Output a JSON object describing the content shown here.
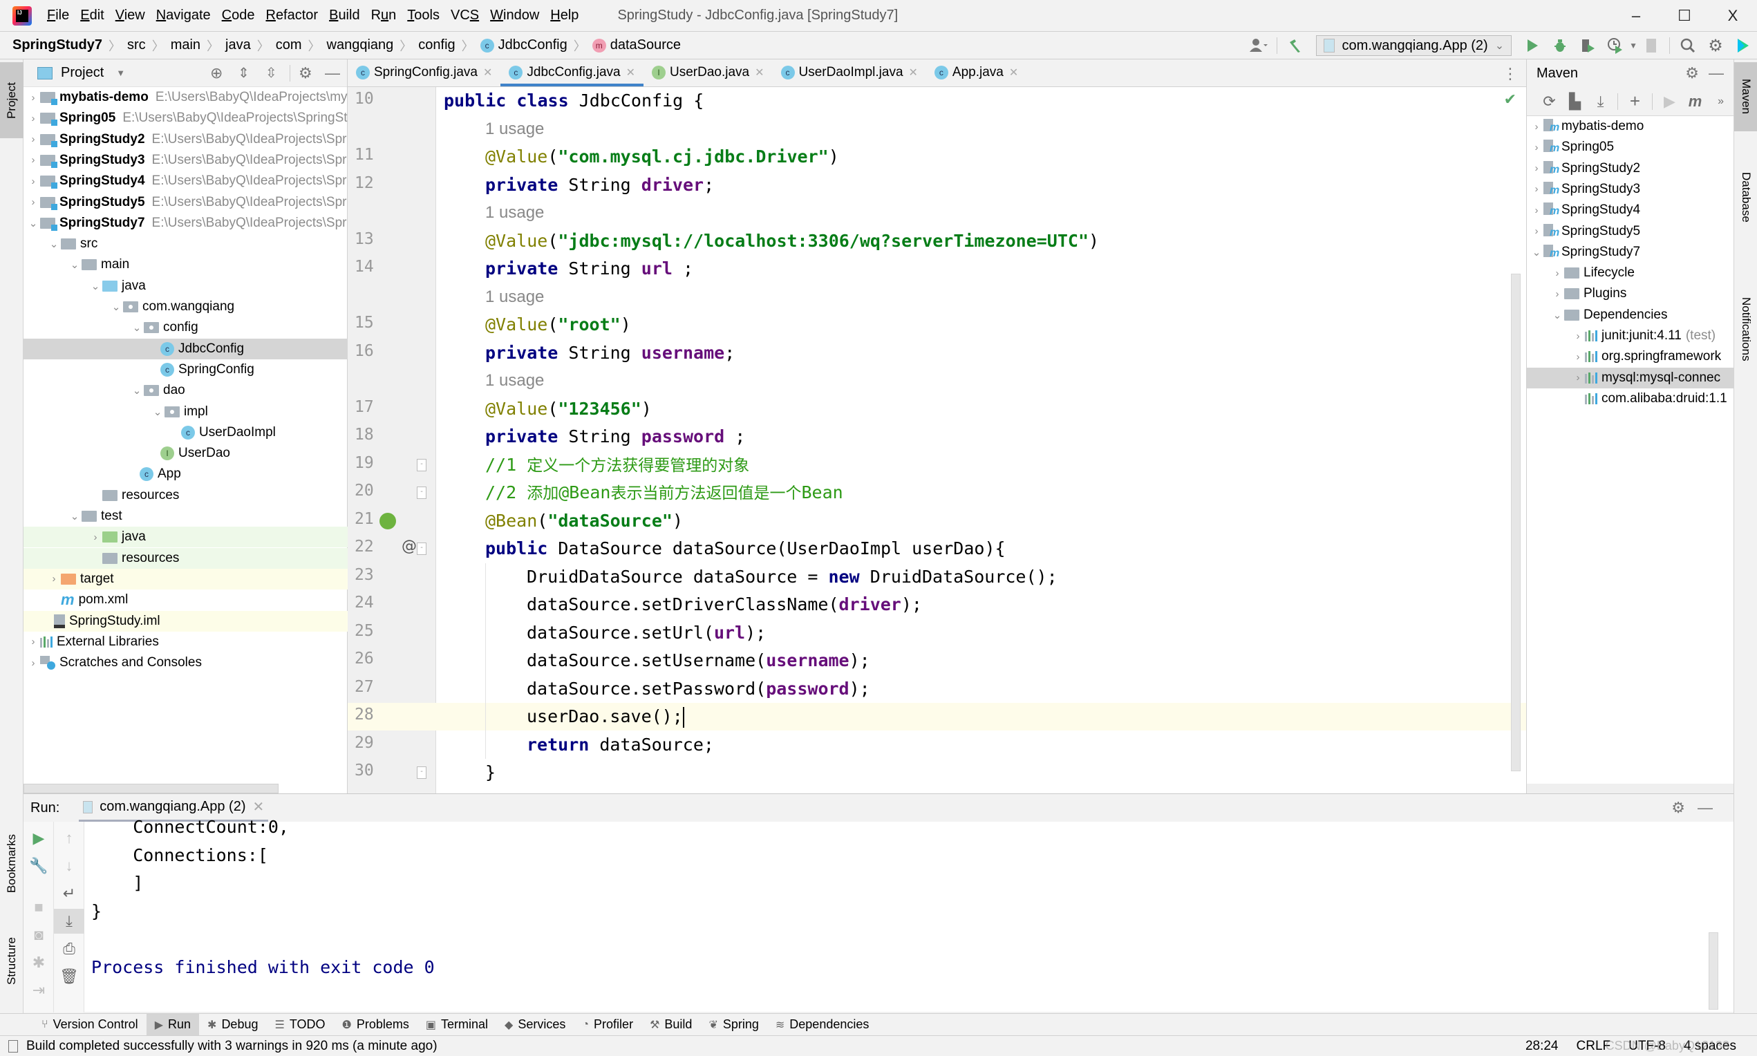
{
  "window": {
    "title": "SpringStudy - JdbcConfig.java [SpringStudy7]",
    "menu": [
      "File",
      "Edit",
      "View",
      "Navigate",
      "Code",
      "Refactor",
      "Build",
      "Run",
      "Tools",
      "VCS",
      "Window",
      "Help"
    ],
    "menu_mnemonics": [
      "F",
      "E",
      "V",
      "N",
      "C",
      "R",
      "B",
      "u",
      "T",
      "S",
      "W",
      "H"
    ],
    "controls": {
      "minimize": "–",
      "maximize": "☐",
      "close": "X"
    }
  },
  "breadcrumb": {
    "items": [
      "SpringStudy7",
      "src",
      "main",
      "java",
      "com",
      "wangqiang",
      "config",
      "JdbcConfig",
      "dataSource"
    ],
    "class_badge": "c",
    "method_badge": "m"
  },
  "toolbar": {
    "run_config": "com.wangqiang.App (2)",
    "icons": [
      "user-icon",
      "build-hammer-icon",
      "run-icon",
      "debug-icon",
      "coverage-icon",
      "profile-icon",
      "stop-icon",
      "search-icon",
      "settings-icon",
      "toolbox-icon"
    ]
  },
  "left_stripe": {
    "tabs": [
      "Project",
      "Bookmarks",
      "Structure"
    ]
  },
  "right_stripe": {
    "tabs": [
      "Maven",
      "Database",
      "Notifications"
    ]
  },
  "project_panel": {
    "title": "Project",
    "tree": [
      {
        "label": "mybatis-demo",
        "path": "E:\\Users\\BabyQ\\IdeaProjects\\mybatis-demo",
        "bold": true,
        "depth": 0,
        "arrow": ">",
        "icon": "module-folder"
      },
      {
        "label": "Spring05",
        "path": "E:\\Users\\BabyQ\\IdeaProjects\\SpringStudy",
        "bold": true,
        "depth": 0,
        "arrow": ">",
        "icon": "module-folder"
      },
      {
        "label": "SpringStudy2",
        "path": "E:\\Users\\BabyQ\\IdeaProjects\\Spr",
        "bold": true,
        "depth": 0,
        "arrow": ">",
        "icon": "module-folder"
      },
      {
        "label": "SpringStudy3",
        "path": "E:\\Users\\BabyQ\\IdeaProjects\\Spr",
        "bold": true,
        "depth": 0,
        "arrow": ">",
        "icon": "module-folder"
      },
      {
        "label": "SpringStudy4",
        "path": "E:\\Users\\BabyQ\\IdeaProjects\\Spr",
        "bold": true,
        "depth": 0,
        "arrow": ">",
        "icon": "module-folder"
      },
      {
        "label": "SpringStudy5",
        "path": "E:\\Users\\BabyQ\\IdeaProjects\\Spr",
        "bold": true,
        "depth": 0,
        "arrow": ">",
        "icon": "module-folder"
      },
      {
        "label": "SpringStudy7",
        "path": "E:\\Users\\BabyQ\\IdeaProjects\\Spr",
        "bold": true,
        "depth": 0,
        "arrow": "v",
        "icon": "module-folder"
      },
      {
        "label": "src",
        "depth": 1,
        "arrow": "v",
        "icon": "folder"
      },
      {
        "label": "main",
        "depth": 2,
        "arrow": "v",
        "icon": "folder"
      },
      {
        "label": "java",
        "depth": 3,
        "arrow": "v",
        "icon": "source-folder"
      },
      {
        "label": "com.wangqiang",
        "depth": 4,
        "arrow": "v",
        "icon": "package"
      },
      {
        "label": "config",
        "depth": 5,
        "arrow": "v",
        "icon": "package"
      },
      {
        "label": "JdbcConfig",
        "depth": 6,
        "arrow": "",
        "icon": "class",
        "selected": true
      },
      {
        "label": "SpringConfig",
        "depth": 6,
        "arrow": "",
        "icon": "class"
      },
      {
        "label": "dao",
        "depth": 5,
        "arrow": "v",
        "icon": "package"
      },
      {
        "label": "impl",
        "depth": 6,
        "arrow": "v",
        "icon": "package"
      },
      {
        "label": "UserDaoImpl",
        "depth": 7,
        "arrow": "",
        "icon": "class"
      },
      {
        "label": "UserDao",
        "depth": 6,
        "arrow": "",
        "icon": "interface"
      },
      {
        "label": "App",
        "depth": 5,
        "arrow": "",
        "icon": "runnable-class"
      },
      {
        "label": "resources",
        "depth": 3,
        "arrow": "",
        "icon": "resources-folder"
      },
      {
        "label": "test",
        "depth": 2,
        "arrow": "v",
        "icon": "folder"
      },
      {
        "label": "java",
        "depth": 3,
        "arrow": ">",
        "icon": "test-folder",
        "highlight": "green"
      },
      {
        "label": "resources",
        "depth": 3,
        "arrow": "",
        "icon": "test-resources-folder",
        "highlight": "green"
      },
      {
        "label": "target",
        "depth": 1,
        "arrow": ">",
        "icon": "excluded-folder",
        "highlight": "yellow"
      },
      {
        "label": "pom.xml",
        "depth": 1,
        "arrow": "",
        "icon": "maven-file"
      },
      {
        "label": "SpringStudy.iml",
        "depth": 0,
        "arrow": "",
        "icon": "iml-file",
        "highlight": "yellow"
      },
      {
        "label": "External Libraries",
        "depth": -1,
        "arrow": ">",
        "icon": "libraries"
      },
      {
        "label": "Scratches and Consoles",
        "depth": -1,
        "arrow": ">",
        "icon": "scratches"
      }
    ]
  },
  "editor": {
    "tabs": [
      {
        "label": "SpringConfig.java",
        "badge": "c",
        "active": false
      },
      {
        "label": "JdbcConfig.java",
        "badge": "c",
        "active": true
      },
      {
        "label": "UserDao.java",
        "badge": "I",
        "active": false
      },
      {
        "label": "UserDaoImpl.java",
        "badge": "c",
        "active": false
      },
      {
        "label": "App.java",
        "badge": "c",
        "active": false
      }
    ],
    "status_check": "✔",
    "current_line": "28",
    "rows": [
      {
        "ln": "10",
        "indent": 0,
        "tokens": [
          [
            "kw",
            "public "
          ],
          [
            "kw",
            "class "
          ],
          [
            "",
            "JdbcConfig {"
          ]
        ]
      },
      {
        "ln": "",
        "indent": 1,
        "hint": "1 usage"
      },
      {
        "ln": "11",
        "indent": 1,
        "tokens": [
          [
            "ann",
            "@Value"
          ],
          [
            "",
            "("
          ],
          [
            "str",
            "\"com.mysql.cj.jdbc.Driver\""
          ],
          [
            "",
            ")"
          ]
        ]
      },
      {
        "ln": "12",
        "indent": 1,
        "tokens": [
          [
            "kw",
            "private "
          ],
          [
            "",
            "String "
          ],
          [
            "fld",
            "driver"
          ],
          [
            "",
            ";"
          ]
        ]
      },
      {
        "ln": "",
        "indent": 1,
        "hint": "1 usage"
      },
      {
        "ln": "13",
        "indent": 1,
        "tokens": [
          [
            "ann",
            "@Value"
          ],
          [
            "",
            "("
          ],
          [
            "str",
            "\"jdbc:mysql://localhost:3306/wq?serverTimezone=UTC\""
          ],
          [
            "",
            ")"
          ]
        ]
      },
      {
        "ln": "14",
        "indent": 1,
        "tokens": [
          [
            "kw",
            "private "
          ],
          [
            "",
            "String "
          ],
          [
            "fld",
            "url"
          ],
          [
            "",
            " ;"
          ]
        ]
      },
      {
        "ln": "",
        "indent": 1,
        "hint": "1 usage"
      },
      {
        "ln": "15",
        "indent": 1,
        "tokens": [
          [
            "ann",
            "@Value"
          ],
          [
            "",
            "("
          ],
          [
            "str",
            "\"root\""
          ],
          [
            "",
            ")"
          ]
        ]
      },
      {
        "ln": "16",
        "indent": 1,
        "tokens": [
          [
            "kw",
            "private "
          ],
          [
            "",
            "String "
          ],
          [
            "fld",
            "username"
          ],
          [
            "",
            ";"
          ]
        ]
      },
      {
        "ln": "",
        "indent": 1,
        "hint": "1 usage"
      },
      {
        "ln": "17",
        "indent": 1,
        "tokens": [
          [
            "ann",
            "@Value"
          ],
          [
            "",
            "("
          ],
          [
            "str",
            "\"123456\""
          ],
          [
            "",
            ")"
          ]
        ]
      },
      {
        "ln": "18",
        "indent": 1,
        "tokens": [
          [
            "kw",
            "private "
          ],
          [
            "",
            "String "
          ],
          [
            "fld",
            "password"
          ],
          [
            "",
            " ;"
          ]
        ]
      },
      {
        "ln": "19",
        "indent": 1,
        "fold": "open",
        "tokens": [
          [
            "cmt",
            "//1 "
          ],
          [
            "cmt-zh",
            "定义一个方法获得要管理的对象"
          ]
        ]
      },
      {
        "ln": "20",
        "indent": 1,
        "fold": "close",
        "tokens": [
          [
            "cmt",
            "//2 "
          ],
          [
            "cmt-zh",
            "添加"
          ],
          [
            "cmt",
            "@Bean"
          ],
          [
            "cmt-zh",
            "表示当前方法返回值是一个"
          ],
          [
            "cmt",
            "Bean"
          ]
        ]
      },
      {
        "ln": "21",
        "indent": 1,
        "gutter_icon": "spring-bean-icon",
        "tokens": [
          [
            "ann",
            "@Bean"
          ],
          [
            "",
            "("
          ],
          [
            "str",
            "\"dataSource\""
          ],
          [
            "",
            ")"
          ]
        ]
      },
      {
        "ln": "22",
        "indent": 1,
        "gutter_icon": "at-icon",
        "fold": "open",
        "tokens": [
          [
            "kw",
            "public "
          ],
          [
            "",
            "DataSource dataSource(UserDaoImpl userDao){"
          ]
        ]
      },
      {
        "ln": "23",
        "indent": 2,
        "tokens": [
          [
            "",
            "DruidDataSource dataSource = "
          ],
          [
            "kw",
            "new "
          ],
          [
            "",
            "DruidDataSource();"
          ]
        ]
      },
      {
        "ln": "24",
        "indent": 2,
        "tokens": [
          [
            "",
            "dataSource.setDriverClassName("
          ],
          [
            "fld",
            "driver"
          ],
          [
            "",
            ");"
          ]
        ]
      },
      {
        "ln": "25",
        "indent": 2,
        "tokens": [
          [
            "",
            "dataSource.setUrl("
          ],
          [
            "fld",
            "url"
          ],
          [
            "",
            ");"
          ]
        ]
      },
      {
        "ln": "26",
        "indent": 2,
        "tokens": [
          [
            "",
            "dataSource.setUsername("
          ],
          [
            "fld",
            "username"
          ],
          [
            "",
            ");"
          ]
        ]
      },
      {
        "ln": "27",
        "indent": 2,
        "tokens": [
          [
            "",
            "dataSource.setPassword("
          ],
          [
            "fld",
            "password"
          ],
          [
            "",
            ");"
          ]
        ]
      },
      {
        "ln": "28",
        "indent": 2,
        "caret": true,
        "tokens": [
          [
            "",
            "userDao.save();"
          ]
        ]
      },
      {
        "ln": "29",
        "indent": 2,
        "tokens": [
          [
            "kw",
            "return "
          ],
          [
            "",
            "dataSource;"
          ]
        ]
      },
      {
        "ln": "30",
        "indent": 1,
        "fold": "close",
        "tokens": [
          [
            "",
            "}"
          ]
        ]
      }
    ]
  },
  "maven_panel": {
    "title": "Maven",
    "toolbar": [
      "reload-icon",
      "generate-sources-icon",
      "download-icon",
      "add-icon",
      "run-icon",
      "maven-goal-icon",
      "more-icon"
    ],
    "tree": [
      {
        "label": "mybatis-demo",
        "depth": 0,
        "arrow": ">",
        "icon": "maven-project"
      },
      {
        "label": "Spring05",
        "depth": 0,
        "arrow": ">",
        "icon": "maven-project"
      },
      {
        "label": "SpringStudy2",
        "depth": 0,
        "arrow": ">",
        "icon": "maven-project"
      },
      {
        "label": "SpringStudy3",
        "depth": 0,
        "arrow": ">",
        "icon": "maven-project"
      },
      {
        "label": "SpringStudy4",
        "depth": 0,
        "arrow": ">",
        "icon": "maven-project"
      },
      {
        "label": "SpringStudy5",
        "depth": 0,
        "arrow": ">",
        "icon": "maven-project"
      },
      {
        "label": "SpringStudy7",
        "depth": 0,
        "arrow": "v",
        "icon": "maven-project"
      },
      {
        "label": "Lifecycle",
        "depth": 1,
        "arrow": ">",
        "icon": "config-folder"
      },
      {
        "label": "Plugins",
        "depth": 1,
        "arrow": ">",
        "icon": "config-folder"
      },
      {
        "label": "Dependencies",
        "depth": 1,
        "arrow": "v",
        "icon": "deps-folder"
      },
      {
        "label": "junit:junit:4.11",
        "suffix": "(test)",
        "depth": 2,
        "arrow": ">",
        "icon": "library"
      },
      {
        "label": "org.springframework",
        "depth": 2,
        "arrow": ">",
        "icon": "library"
      },
      {
        "label": "mysql:mysql-connec",
        "depth": 2,
        "arrow": ">",
        "icon": "library",
        "selected": true
      },
      {
        "label": "com.alibaba:druid:1.1",
        "depth": 2,
        "arrow": "",
        "icon": "library"
      }
    ]
  },
  "run_panel": {
    "label": "Run:",
    "tab": "com.wangqiang.App (2)",
    "console": [
      {
        "text": "    ConnectCount:0,",
        "style": "normal"
      },
      {
        "text": "    Connections:[",
        "style": "normal"
      },
      {
        "text": "    ]",
        "style": "normal"
      },
      {
        "text": "}",
        "style": "normal"
      },
      {
        "text": "",
        "style": "normal"
      },
      {
        "text": "Process finished with exit code 0",
        "style": "system"
      }
    ]
  },
  "bottom_tools": [
    {
      "label": "Version Control",
      "icon": "vcs-icon",
      "glyph": "⑂"
    },
    {
      "label": "Run",
      "icon": "run-icon",
      "glyph": "▶",
      "active": true
    },
    {
      "label": "Debug",
      "icon": "debug-icon",
      "glyph": "✱"
    },
    {
      "label": "TODO",
      "icon": "todo-icon",
      "glyph": "☰"
    },
    {
      "label": "Problems",
      "icon": "problems-icon",
      "glyph": "❶"
    },
    {
      "label": "Terminal",
      "icon": "terminal-icon",
      "glyph": "▣"
    },
    {
      "label": "Services",
      "icon": "services-icon",
      "glyph": "◆"
    },
    {
      "label": "Profiler",
      "icon": "profiler-icon",
      "glyph": "◔"
    },
    {
      "label": "Build",
      "icon": "build-icon",
      "glyph": "⚒"
    },
    {
      "label": "Spring",
      "icon": "spring-icon",
      "glyph": "❦"
    },
    {
      "label": "Dependencies",
      "icon": "dependencies-icon",
      "glyph": "≋"
    }
  ],
  "status_bar": {
    "message": "Build completed successfully with 3 warnings in 920 ms (a minute ago)",
    "position": "28:24",
    "line_separator": "CRLF",
    "encoding": "UTF-8",
    "indent": "4 spaces",
    "watermark": "CSDN @BabyQ12138"
  },
  "colors": {
    "keyword": "#000080",
    "annotation": "#808000",
    "string": "#067d17",
    "field": "#660e7a",
    "comment": "#2d9a15",
    "system_output": "#000080",
    "accent": "#4083c9"
  }
}
